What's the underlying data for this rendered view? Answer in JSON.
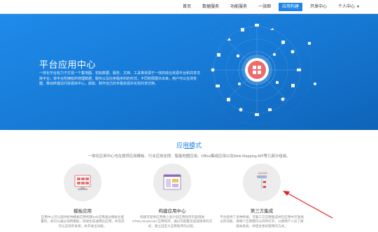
{
  "nav": {
    "items": [
      {
        "label": "首页",
        "active": false
      },
      {
        "label": "数据服务",
        "active": false
      },
      {
        "label": "功能服务",
        "active": false
      },
      {
        "label": "一张图",
        "active": false
      },
      {
        "label": "应用构建",
        "active": true
      },
      {
        "label": "开发中心",
        "active": false
      },
      {
        "label": "个人中心",
        "active": false,
        "dropdown": true
      }
    ]
  },
  "hero": {
    "title": "平台应用中心",
    "description": "一体化平台有力于打造一个集地图、初始数据、服务、文档、工具等资源于一体的综合资源平台和共享交换平台，将平台所拥有的地理数据、服务以及应用程序利的形式，不同权限展示出来，用户可以在浏览器、移动终端访问资源目中心，获取、制作自己的专题资源并实现共享交换。"
  },
  "section": {
    "title": "应用模式",
    "description": "一体化应用中心也在提供应用模板、行业应用支撑、智能地图应用、Office集成应用以及Web Mapping API等几部分组成。"
  },
  "cards": [
    {
      "title": "模板应用",
      "icon": "template-app-icon",
      "description": "应用中心可以提供各种模板应用构建web应用通过模板化配置的，如可以通过调用模板，快速生成通用化应用，并且还可以支持开发者，并开发出功能。"
    },
    {
      "title": "构建应用中心",
      "icon": "builder-app-icon",
      "description": "构建可提供应用像上设计您应用程序内容借助 HTML/JavaScript 应用程序，通过可配置且直观简单的方式，建立自定义应用程序的过程。"
    },
    {
      "title": "第三方集成",
      "icon": "third-party-icon",
      "description": "平台提供了多种终端，可集三方应用集成并在应用中开放通过的功能，把每个应用都可以同时打开，以便用户人员了解相关系统，并结合更好使用的方式。"
    }
  ],
  "colors": {
    "accent": "#1e86e6",
    "hero": "#1678d3",
    "annotation": "#e02020"
  }
}
